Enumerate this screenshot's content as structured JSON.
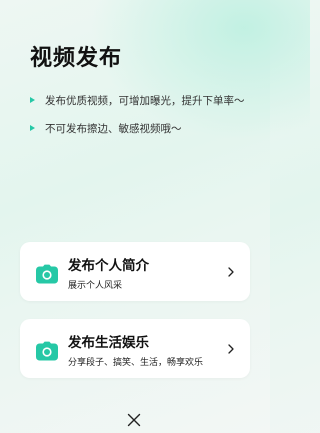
{
  "page": {
    "title": "视频发布"
  },
  "tips": [
    "发布优质视频，可增加曝光，提升下单率～",
    "不可发布擦边、敏感视频哦～"
  ],
  "options": [
    {
      "title": "发布个人简介",
      "subtitle": "展示个人风采",
      "icon": "camera-icon"
    },
    {
      "title": "发布生活娱乐",
      "subtitle": "分享段子、搞笑、生活，畅享欢乐",
      "icon": "camera-icon"
    }
  ],
  "icons": {
    "tip_marker": "triangle-right-icon",
    "chevron": "chevron-right-icon",
    "close": "close-icon"
  },
  "colors": {
    "accent": "#26c8a6",
    "card_bg": "#ffffff"
  }
}
